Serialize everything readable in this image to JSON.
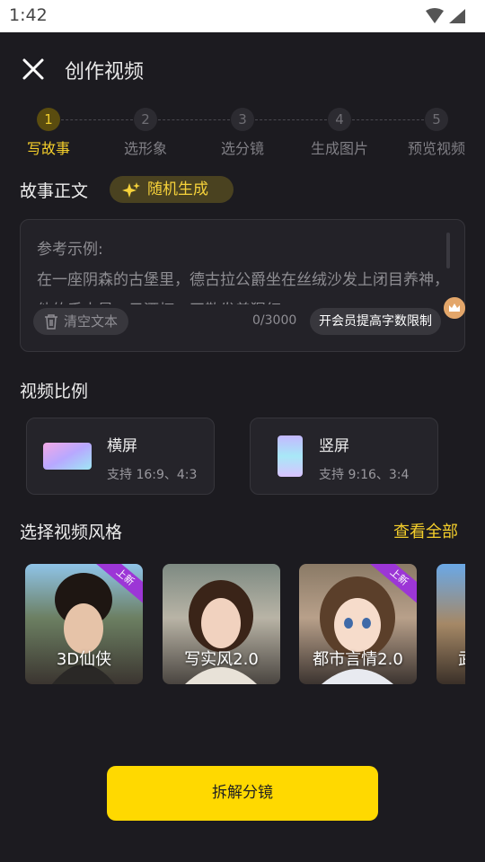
{
  "status_bar": {
    "time": "1:42"
  },
  "header": {
    "title": "创作视频"
  },
  "steps": [
    {
      "number": "1",
      "label": "写故事",
      "active": true
    },
    {
      "number": "2",
      "label": "选形象",
      "active": false
    },
    {
      "number": "3",
      "label": "选分镜",
      "active": false
    },
    {
      "number": "4",
      "label": "生成图片",
      "active": false
    },
    {
      "number": "5",
      "label": "预览视频",
      "active": false
    }
  ],
  "story": {
    "title": "故事正文",
    "random_label": "随机生成",
    "example_label": "参考示例:",
    "example_text": "在一座阴森的古堡里，德古拉公爵坐在丝绒沙发上闭目养神，他的手中是一只酒杯，正散发着猩红",
    "clear_label": "清空文本",
    "counter": "0/3000",
    "vip_label": "开会员提高字数限制"
  },
  "ratio": {
    "title": "视频比例",
    "options": [
      {
        "label": "横屏",
        "sub": "支持 16:9、4:3"
      },
      {
        "label": "竖屏",
        "sub": "支持 9:16、3:4"
      }
    ]
  },
  "styles": {
    "title": "选择视频风格",
    "see_all": "查看全部",
    "items": [
      {
        "label": "3D仙侠",
        "badge": "上新"
      },
      {
        "label": "写实风2.0",
        "badge": ""
      },
      {
        "label": "都市言情2.0",
        "badge": "上新"
      },
      {
        "label": "武",
        "badge": ""
      }
    ]
  },
  "primary_button": {
    "label": "拆解分镜"
  },
  "colors": {
    "accent": "#ffd900",
    "background": "#1c1b20",
    "active_step": "#f5cf2b"
  }
}
